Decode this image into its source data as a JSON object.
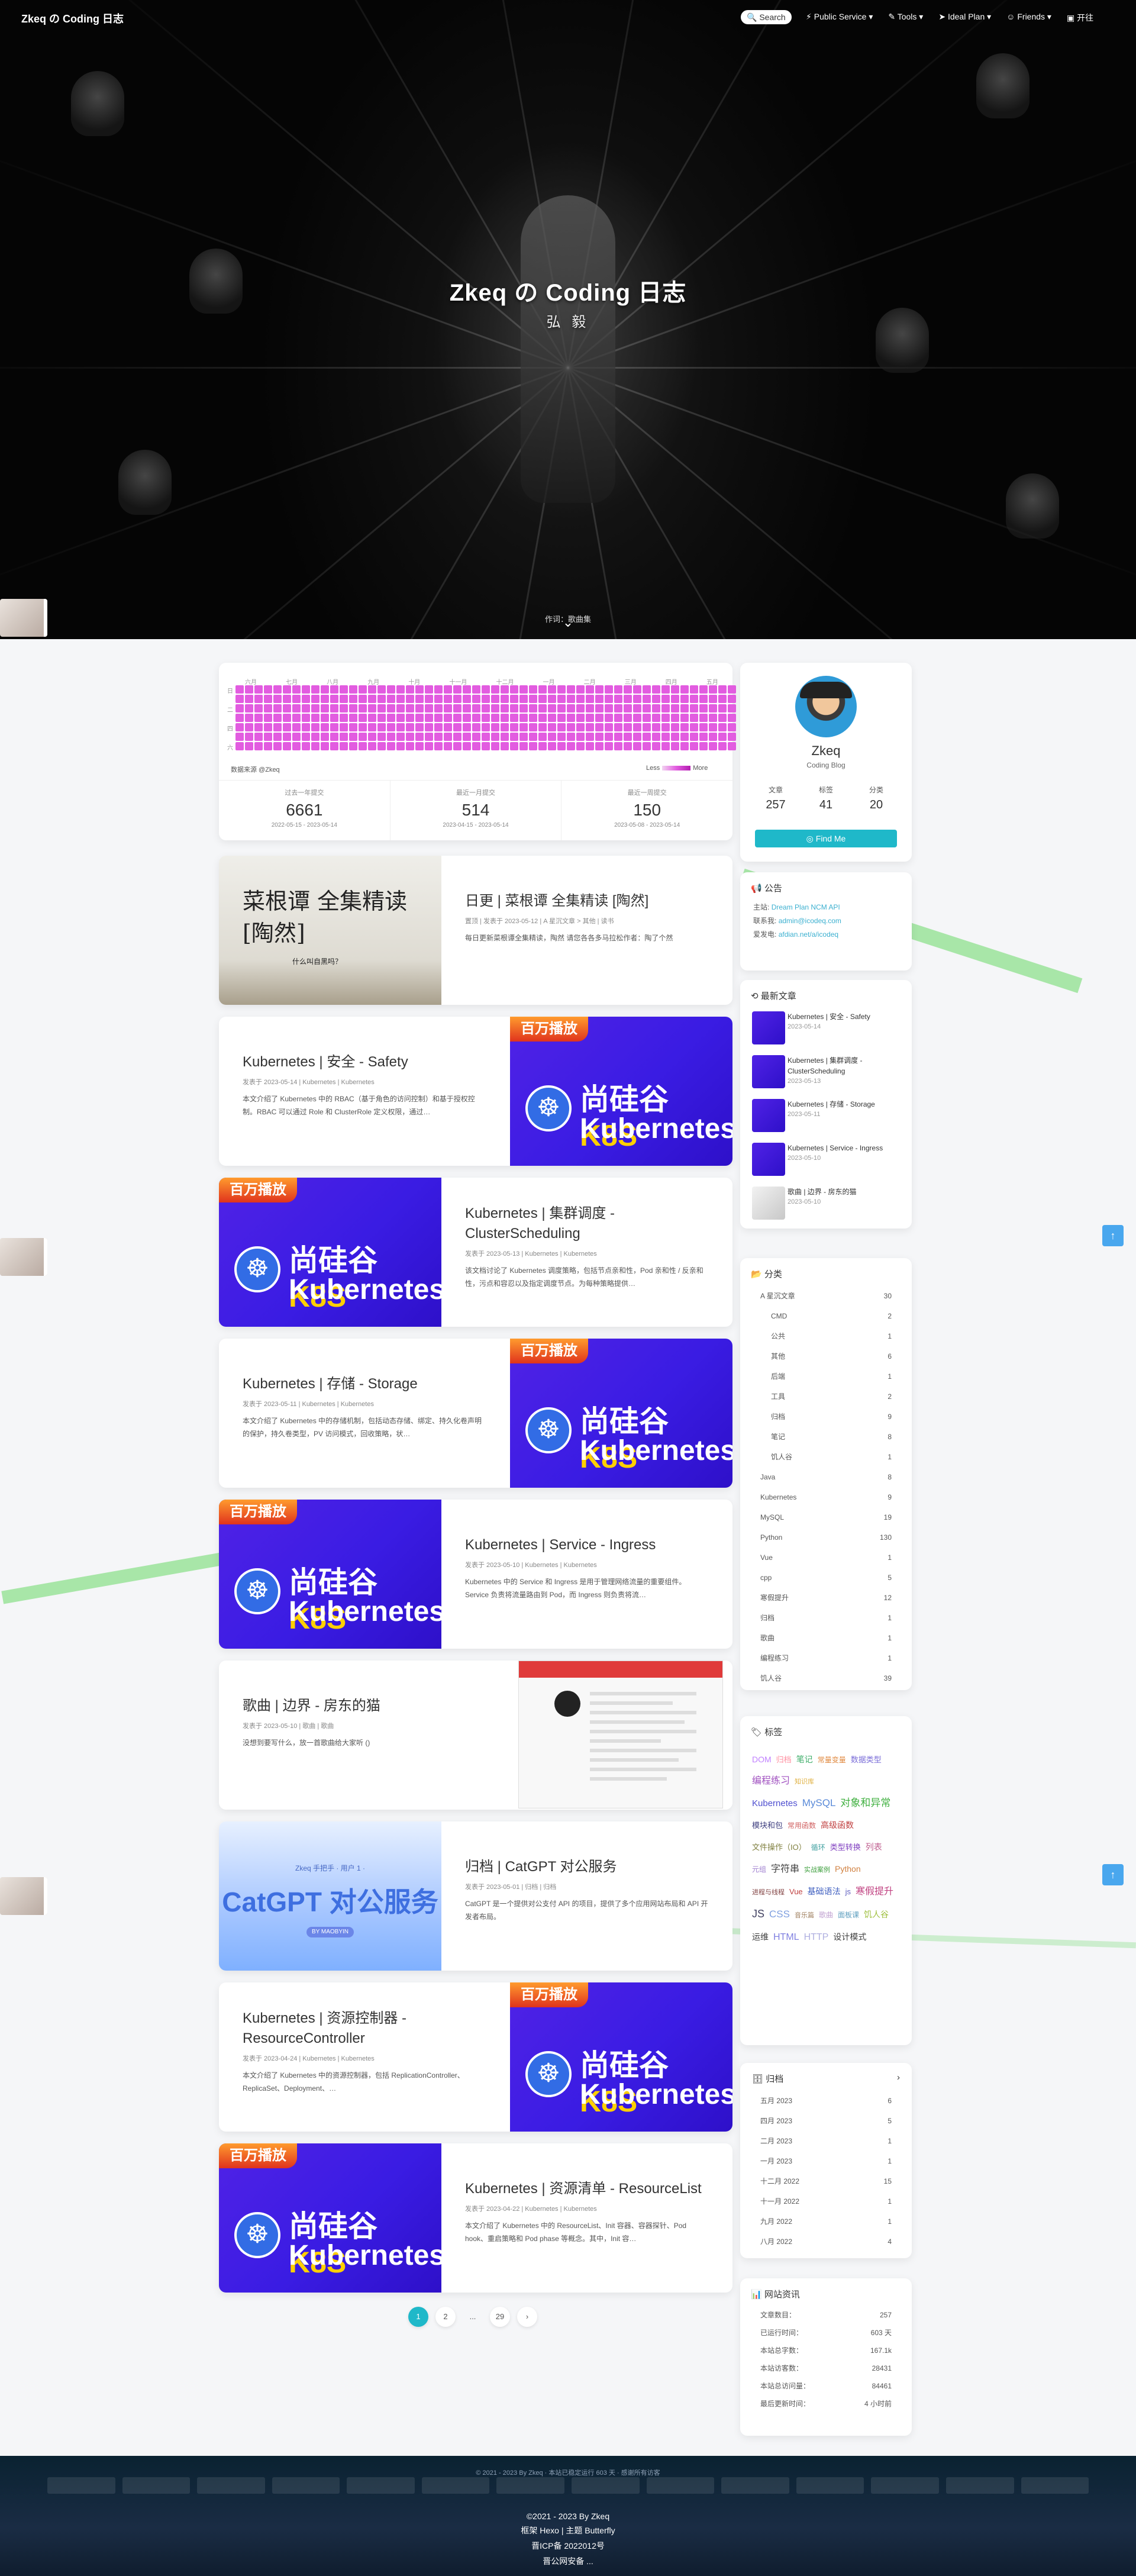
{
  "colors": {
    "accent": "#1fb8c9",
    "heat": "#e25ce0",
    "k8s_bg": "#4a1fe4",
    "link": "#3cb0d0",
    "top_button": "#49a7ee"
  },
  "nav": {
    "site_name": "Zkeq の Coding 日志",
    "search_label": "Search",
    "menu": [
      "Public Service",
      "Tools",
      "Ideal Plan",
      "Friends",
      "开往"
    ],
    "icons": [
      "search-icon",
      "service-icon",
      "tools-icon",
      "plane-icon",
      "friends-icon",
      "train-icon"
    ]
  },
  "hero": {
    "title": "Zkeq の Coding 日志",
    "subtitle": "弘 毅",
    "caption": "作词：歌曲集"
  },
  "heatmap": {
    "months": [
      "六月",
      "七月",
      "八月",
      "九月",
      "十月",
      "十一月",
      "十二月",
      "一月",
      "二月",
      "三月",
      "四月",
      "五月"
    ],
    "days": [
      "日",
      "二",
      "四",
      "六"
    ],
    "source": "数据来源 @Zkeq",
    "legend_low": "Less",
    "legend_high": "More",
    "stats": [
      {
        "label": "过去一年提交",
        "value": "6661",
        "range": "2022-05-15 - 2023-05-14"
      },
      {
        "label": "最近一月提交",
        "value": "514",
        "range": "2023-04-15 - 2023-05-14"
      },
      {
        "label": "最近一周提交",
        "value": "150",
        "range": "2023-05-08 - 2023-05-14"
      }
    ]
  },
  "posts": [
    {
      "title": "日更 | 菜根谭 全集精读 [陶然]",
      "meta": "置顶 | 发表于 2023-05-12 | A 星沉文章 > 其他 | 读书",
      "excerpt": "每日更新菜根谭全集精读，陶然 请您各各多马拉松作者：陶了个然",
      "cover": "ink",
      "cover_text": "菜根谭 全集精读 [陶然]",
      "cover_stamp": "什么叫自黑吗？"
    },
    {
      "title": "Kubernetes | 安全 - Safety",
      "meta": "发表于 2023-05-14 | Kubernetes | Kubernetes",
      "excerpt": "本文介绍了 Kubernetes 中的 RBAC（基于角色的访问控制）和基于授权控制。RBAC 可以通过 Role 和 ClusterRole 定义权限，通过…",
      "cover": "k8s"
    },
    {
      "title": "Kubernetes | 集群调度 - ClusterScheduling",
      "meta": "发表于 2023-05-13 | Kubernetes | Kubernetes",
      "excerpt": "该文档讨论了 Kubernetes 调度策略，包括节点亲和性，Pod 亲和性 / 反亲和性，污点和容忍以及指定调度节点。为每种策略提供…",
      "cover": "k8s"
    },
    {
      "title": "Kubernetes | 存储 - Storage",
      "meta": "发表于 2023-05-11 | Kubernetes | Kubernetes",
      "excerpt": "本文介绍了 Kubernetes 中的存储机制，包括动态存储、绑定、持久化卷声明的保护，持久卷类型，PV 访问模式，回收策略，状…",
      "cover": "k8s"
    },
    {
      "title": "Kubernetes | Service - Ingress",
      "meta": "发表于 2023-05-10 | Kubernetes | Kubernetes",
      "excerpt": "Kubernetes 中的 Service 和 Ingress 是用于管理网络流量的重要组件。Service 负责将流量路由到 Pod，而 Ingress 则负责将流…",
      "cover": "k8s"
    },
    {
      "title": "歌曲 | 边界 - 房东的猫",
      "meta": "发表于 2023-05-10 | 歌曲 | 歌曲",
      "excerpt": "没想到要写什么，放一首歌曲给大家听 ()",
      "cover": "shot"
    },
    {
      "title": "归档 | CatGPT 对公服务",
      "meta": "发表于 2023-05-01 | 归档 | 归档",
      "excerpt": "CatGPT 是一个提供对公支付 API 的项目，提供了多个应用网站布局和 API 开发者布局。",
      "cover": "catgpt",
      "cover_small": "Zkeq 手把手 · 用户 1 ·",
      "cover_big": "CatGPT 对公服务",
      "cover_pill": "BY MAOBYIN"
    },
    {
      "title": "Kubernetes | 资源控制器 - ResourceController",
      "meta": "发表于 2023-04-24 | Kubernetes | Kubernetes",
      "excerpt": "本文介绍了 Kubernetes 中的资源控制器，包括 ReplicationController、ReplicaSet、Deployment、…",
      "cover": "k8s"
    },
    {
      "title": "Kubernetes | 资源清单 - ResourceList",
      "meta": "发表于 2023-04-22 | Kubernetes | Kubernetes",
      "excerpt": "本文介绍了 Kubernetes 中的 ResourceList、Init 容器、容器探针、Pod hook、重启策略和 Pod phase 等概念。其中，Init 容…",
      "cover": "k8s"
    }
  ],
  "k8s_cover": {
    "badge": "百万播放",
    "line1_a": "尚硅谷",
    "line1_b": "K8S",
    "line2": "Kubernetes"
  },
  "pagination": {
    "pages": [
      "1",
      "2",
      "...",
      "29"
    ],
    "next": "›"
  },
  "profile": {
    "author": "Zkeq",
    "desc": "Coding Blog",
    "stats": [
      {
        "k": "文章",
        "v": "257"
      },
      {
        "k": "标签",
        "v": "41"
      },
      {
        "k": "分类",
        "v": "20"
      }
    ],
    "follow": "Find Me"
  },
  "announce": {
    "title": "公告",
    "lines": [
      {
        "label": "主站:",
        "links": "Dream Plan  NCM API"
      },
      {
        "label": "联系我:",
        "links": "admin@icodeq.com"
      },
      {
        "label": "爱发电:",
        "links": "afdian.net/a/icodeq"
      }
    ]
  },
  "recent": {
    "title": "最新文章",
    "items": [
      {
        "t": "Kubernetes | 安全 - Safety",
        "d": "2023-05-14",
        "kind": "k8s"
      },
      {
        "t": "Kubernetes | 集群调度 - ClusterScheduling",
        "d": "2023-05-13",
        "kind": "k8s"
      },
      {
        "t": "Kubernetes | 存储 - Storage",
        "d": "2023-05-11",
        "kind": "k8s"
      },
      {
        "t": "Kubernetes | Service - Ingress",
        "d": "2023-05-10",
        "kind": "k8s"
      },
      {
        "t": "歌曲 | 边界 - 房东的猫",
        "d": "2023-05-10",
        "kind": "song"
      }
    ]
  },
  "categories": {
    "title": "分类",
    "items": [
      {
        "n": "A 星沉文章",
        "c": "30",
        "child": false
      },
      {
        "n": "CMD",
        "c": "2",
        "child": true
      },
      {
        "n": "公共",
        "c": "1",
        "child": true
      },
      {
        "n": "其他",
        "c": "6",
        "child": true
      },
      {
        "n": "后端",
        "c": "1",
        "child": true
      },
      {
        "n": "工具",
        "c": "2",
        "child": true
      },
      {
        "n": "归档",
        "c": "9",
        "child": true
      },
      {
        "n": "笔记",
        "c": "8",
        "child": true
      },
      {
        "n": "饥人谷",
        "c": "1",
        "child": true
      },
      {
        "n": "Java",
        "c": "8",
        "child": false
      },
      {
        "n": "Kubernetes",
        "c": "9",
        "child": false
      },
      {
        "n": "MySQL",
        "c": "19",
        "child": false
      },
      {
        "n": "Python",
        "c": "130",
        "child": false
      },
      {
        "n": "Vue",
        "c": "1",
        "child": false
      },
      {
        "n": "cpp",
        "c": "5",
        "child": false
      },
      {
        "n": "寒假提升",
        "c": "12",
        "child": false
      },
      {
        "n": "归档",
        "c": "1",
        "child": false
      },
      {
        "n": "歌曲",
        "c": "1",
        "child": false
      },
      {
        "n": "编程练习",
        "c": "1",
        "child": false
      },
      {
        "n": "饥人谷",
        "c": "39",
        "child": false
      }
    ]
  },
  "tags": {
    "title": "标签",
    "items": [
      {
        "t": "DOM",
        "c": "#c080ff",
        "s": 14
      },
      {
        "t": "归档",
        "c": "#ff8fa0",
        "s": 13
      },
      {
        "t": "笔记",
        "c": "#3fae6a",
        "s": 14
      },
      {
        "t": "常量变量",
        "c": "#e08a40",
        "s": 12
      },
      {
        "t": "数据类型",
        "c": "#7a6dd8",
        "s": 13
      },
      {
        "t": "编程练习",
        "c": "#a050c0",
        "s": 16
      },
      {
        "t": "知识库",
        "c": "#e0b040",
        "s": 11
      },
      {
        "t": "Kubernetes",
        "c": "#5050d0",
        "s": 15
      },
      {
        "t": "MySQL",
        "c": "#5a8ad8",
        "s": 17
      },
      {
        "t": "对象和异常",
        "c": "#40b040",
        "s": 17
      },
      {
        "t": "模块和包",
        "c": "#404080",
        "s": 13
      },
      {
        "t": "常用函数",
        "c": "#d06060",
        "s": 12
      },
      {
        "t": "高级函数",
        "c": "#c04040",
        "s": 14
      },
      {
        "t": "文件操作（IO）",
        "c": "#808040",
        "s": 13
      },
      {
        "t": "循环",
        "c": "#40a0a0",
        "s": 12
      },
      {
        "t": "类型转换",
        "c": "#8040c0",
        "s": 13
      },
      {
        "t": "列表",
        "c": "#c06090",
        "s": 14
      },
      {
        "t": "元组",
        "c": "#a080d0",
        "s": 12
      },
      {
        "t": "字符串",
        "c": "#404040",
        "s": 16
      },
      {
        "t": "实战案例",
        "c": "#40a040",
        "s": 11
      },
      {
        "t": "Python",
        "c": "#d08040",
        "s": 14
      },
      {
        "t": "进程与线程",
        "c": "#804040",
        "s": 11
      },
      {
        "t": "Vue",
        "c": "#c04040",
        "s": 13
      },
      {
        "t": "基础语法",
        "c": "#4060c0",
        "s": 14
      },
      {
        "t": "js",
        "c": "#6060c0",
        "s": 13
      },
      {
        "t": "寒假提升",
        "c": "#c04080",
        "s": 16
      },
      {
        "t": "JS",
        "c": "#404060",
        "s": 18
      },
      {
        "t": "CSS",
        "c": "#80a0e0",
        "s": 17
      },
      {
        "t": "音乐篇",
        "c": "#a08060",
        "s": 11
      },
      {
        "t": "歌曲",
        "c": "#c0a0d0",
        "s": 12
      },
      {
        "t": "面板课",
        "c": "#60a0c0",
        "s": 12
      },
      {
        "t": "饥人谷",
        "c": "#a0c040",
        "s": 14
      },
      {
        "t": "运维",
        "c": "#404040",
        "s": 14
      },
      {
        "t": "HTML",
        "c": "#8080e0",
        "s": 16
      },
      {
        "t": "HTTP",
        "c": "#b0b0e0",
        "s": 16
      },
      {
        "t": "设计模式",
        "c": "#404040",
        "s": 14
      }
    ]
  },
  "archive": {
    "title": "归档",
    "items": [
      {
        "m": "五月 2023",
        "c": "6"
      },
      {
        "m": "四月 2023",
        "c": "5"
      },
      {
        "m": "二月 2023",
        "c": "1"
      },
      {
        "m": "一月 2023",
        "c": "1"
      },
      {
        "m": "十二月 2022",
        "c": "15"
      },
      {
        "m": "十一月 2022",
        "c": "1"
      },
      {
        "m": "九月 2022",
        "c": "1"
      },
      {
        "m": "八月 2022",
        "c": "4"
      }
    ]
  },
  "siteinfo": {
    "title": "网站资讯",
    "items": [
      {
        "k": "文章数目：",
        "v": "257"
      },
      {
        "k": "已运行时间：",
        "v": "603 天"
      },
      {
        "k": "本站总字数：",
        "v": "167.1k"
      },
      {
        "k": "本站访客数：",
        "v": "28431"
      },
      {
        "k": "本站总访问量：",
        "v": "84461"
      },
      {
        "k": "最后更新时间：",
        "v": "4 小时前"
      }
    ]
  },
  "footer": {
    "strip": "© 2021 - 2023 By Zkeq · 本站已稳定运行 603 天 · 感谢所有访客",
    "copy": "©2021 - 2023 By Zkeq",
    "theme": "框架 Hexo | 主题 Butterfly",
    "icp": "晋ICP备 2022012号",
    "police": "晋公网安备 ..."
  }
}
